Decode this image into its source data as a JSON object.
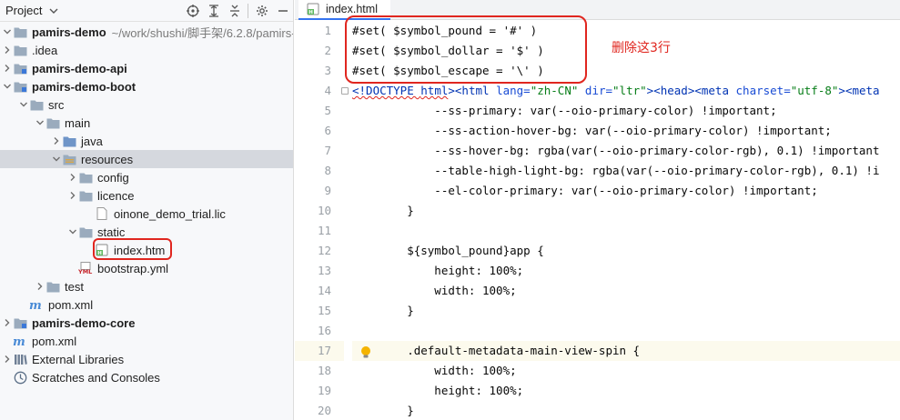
{
  "project_panel": {
    "title": "Project",
    "icons": [
      "target-icon",
      "expand-all-icon",
      "collapse-all-icon",
      "gear-icon",
      "hide-icon"
    ]
  },
  "tree": [
    {
      "depth": 0,
      "arrow": "down",
      "icon": "folder",
      "label": "pamirs-demo",
      "bold": true,
      "path": "~/work/shushi/脚手架/6.2.8/pamirs-"
    },
    {
      "depth": 0,
      "arrow": "right",
      "icon": "folder",
      "label": ".idea"
    },
    {
      "depth": 0,
      "arrow": "right",
      "icon": "module",
      "label": "pamirs-demo-api",
      "bold": true
    },
    {
      "depth": 0,
      "arrow": "down",
      "icon": "module",
      "label": "pamirs-demo-boot",
      "bold": true
    },
    {
      "depth": 1,
      "arrow": "down",
      "icon": "folder",
      "label": "src"
    },
    {
      "depth": 2,
      "arrow": "down",
      "icon": "folder",
      "label": "main"
    },
    {
      "depth": 3,
      "arrow": "right",
      "icon": "folder-blue",
      "label": "java"
    },
    {
      "depth": 3,
      "arrow": "down",
      "icon": "folder-res",
      "label": "resources",
      "selected": true
    },
    {
      "depth": 4,
      "arrow": "right",
      "icon": "folder",
      "label": "config"
    },
    {
      "depth": 4,
      "arrow": "right",
      "icon": "folder",
      "label": "licence"
    },
    {
      "depth": 5,
      "arrow": "",
      "icon": "file",
      "label": "oinone_demo_trial.lic"
    },
    {
      "depth": 4,
      "arrow": "down",
      "icon": "folder",
      "label": "static"
    },
    {
      "depth": 5,
      "arrow": "",
      "icon": "html",
      "label": "index.htm"
    },
    {
      "depth": 4,
      "arrow": "",
      "icon": "yml",
      "label": "bootstrap.yml"
    },
    {
      "depth": 2,
      "arrow": "right",
      "icon": "folder",
      "label": "test"
    },
    {
      "depth": 1,
      "arrow": "",
      "icon": "maven",
      "label": "pom.xml"
    },
    {
      "depth": 0,
      "arrow": "right",
      "icon": "module",
      "label": "pamirs-demo-core",
      "bold": true
    },
    {
      "depth": 0,
      "arrow": "",
      "icon": "maven",
      "label": "pom.xml"
    },
    {
      "depth": 0,
      "arrow": "right",
      "icon": "library",
      "label": "External Libraries"
    },
    {
      "depth": 0,
      "arrow": "",
      "icon": "scratch",
      "label": "Scratches and Consoles"
    }
  ],
  "editor": {
    "tab_label": "index.html",
    "annotation": "删除这3行",
    "current_line": 17,
    "lines": [
      {
        "n": "1",
        "segments": [
          {
            "t": "#set( $symbol_pound = '#' )"
          }
        ]
      },
      {
        "n": "2",
        "segments": [
          {
            "t": "#set( $symbol_dollar = '$' )"
          }
        ]
      },
      {
        "n": "3",
        "segments": [
          {
            "t": "#set( $symbol_escape = '\\' )"
          }
        ]
      },
      {
        "n": "4",
        "segments": [
          {
            "t": "<!DOCTYPE ",
            "c": "tag squig"
          },
          {
            "t": "html",
            "c": "tag squig"
          },
          {
            "t": ">",
            "c": "tag"
          },
          {
            "t": "<html ",
            "c": "tag"
          },
          {
            "t": "lang=",
            "c": "attr"
          },
          {
            "t": "\"zh-CN\"",
            "c": "str"
          },
          {
            "t": " "
          },
          {
            "t": "dir=",
            "c": "attr"
          },
          {
            "t": "\"ltr\"",
            "c": "str"
          },
          {
            "t": ">",
            "c": "tag"
          },
          {
            "t": "<head>",
            "c": "tag"
          },
          {
            "t": "<meta ",
            "c": "tag"
          },
          {
            "t": "charset=",
            "c": "attr"
          },
          {
            "t": "\"utf-8\"",
            "c": "str"
          },
          {
            "t": ">",
            "c": "tag"
          },
          {
            "t": "<meta",
            "c": "tag"
          }
        ]
      },
      {
        "n": "5",
        "segments": [
          {
            "t": "            --ss-primary: var(--oio-primary-color) !important;"
          }
        ]
      },
      {
        "n": "6",
        "segments": [
          {
            "t": "            --ss-action-hover-bg: var(--oio-primary-color) !important;"
          }
        ]
      },
      {
        "n": "7",
        "segments": [
          {
            "t": "            --ss-hover-bg: rgba(var(--oio-primary-color-rgb), 0.1) !important"
          }
        ]
      },
      {
        "n": "8",
        "segments": [
          {
            "t": "            --table-high-light-bg: rgba(var(--oio-primary-color-rgb), 0.1) !i"
          }
        ]
      },
      {
        "n": "9",
        "segments": [
          {
            "t": "            --el-color-primary: var(--oio-primary-color) !important;"
          }
        ]
      },
      {
        "n": "10",
        "segments": [
          {
            "t": "        }"
          }
        ]
      },
      {
        "n": "11",
        "segments": [
          {
            "t": ""
          }
        ]
      },
      {
        "n": "12",
        "segments": [
          {
            "t": "        ${symbol_pound}app {"
          }
        ]
      },
      {
        "n": "13",
        "segments": [
          {
            "t": "            height: 100%;"
          }
        ]
      },
      {
        "n": "14",
        "segments": [
          {
            "t": "            width: 100%;"
          }
        ]
      },
      {
        "n": "15",
        "segments": [
          {
            "t": "        }"
          }
        ]
      },
      {
        "n": "16",
        "segments": [
          {
            "t": ""
          }
        ]
      },
      {
        "n": "17",
        "segments": [
          {
            "t": "        .default-metadata-main-view-spin {"
          }
        ]
      },
      {
        "n": "18",
        "segments": [
          {
            "t": "            width: 100%;"
          }
        ]
      },
      {
        "n": "19",
        "segments": [
          {
            "t": "            height: 100%;"
          }
        ]
      },
      {
        "n": "20",
        "segments": [
          {
            "t": "        }"
          }
        ]
      }
    ]
  },
  "colors": {
    "highlight_red": "#e0261f",
    "selection_bg": "#d5d8de",
    "folder": "#8fa4b8",
    "accent_blue": "#3574f0"
  }
}
